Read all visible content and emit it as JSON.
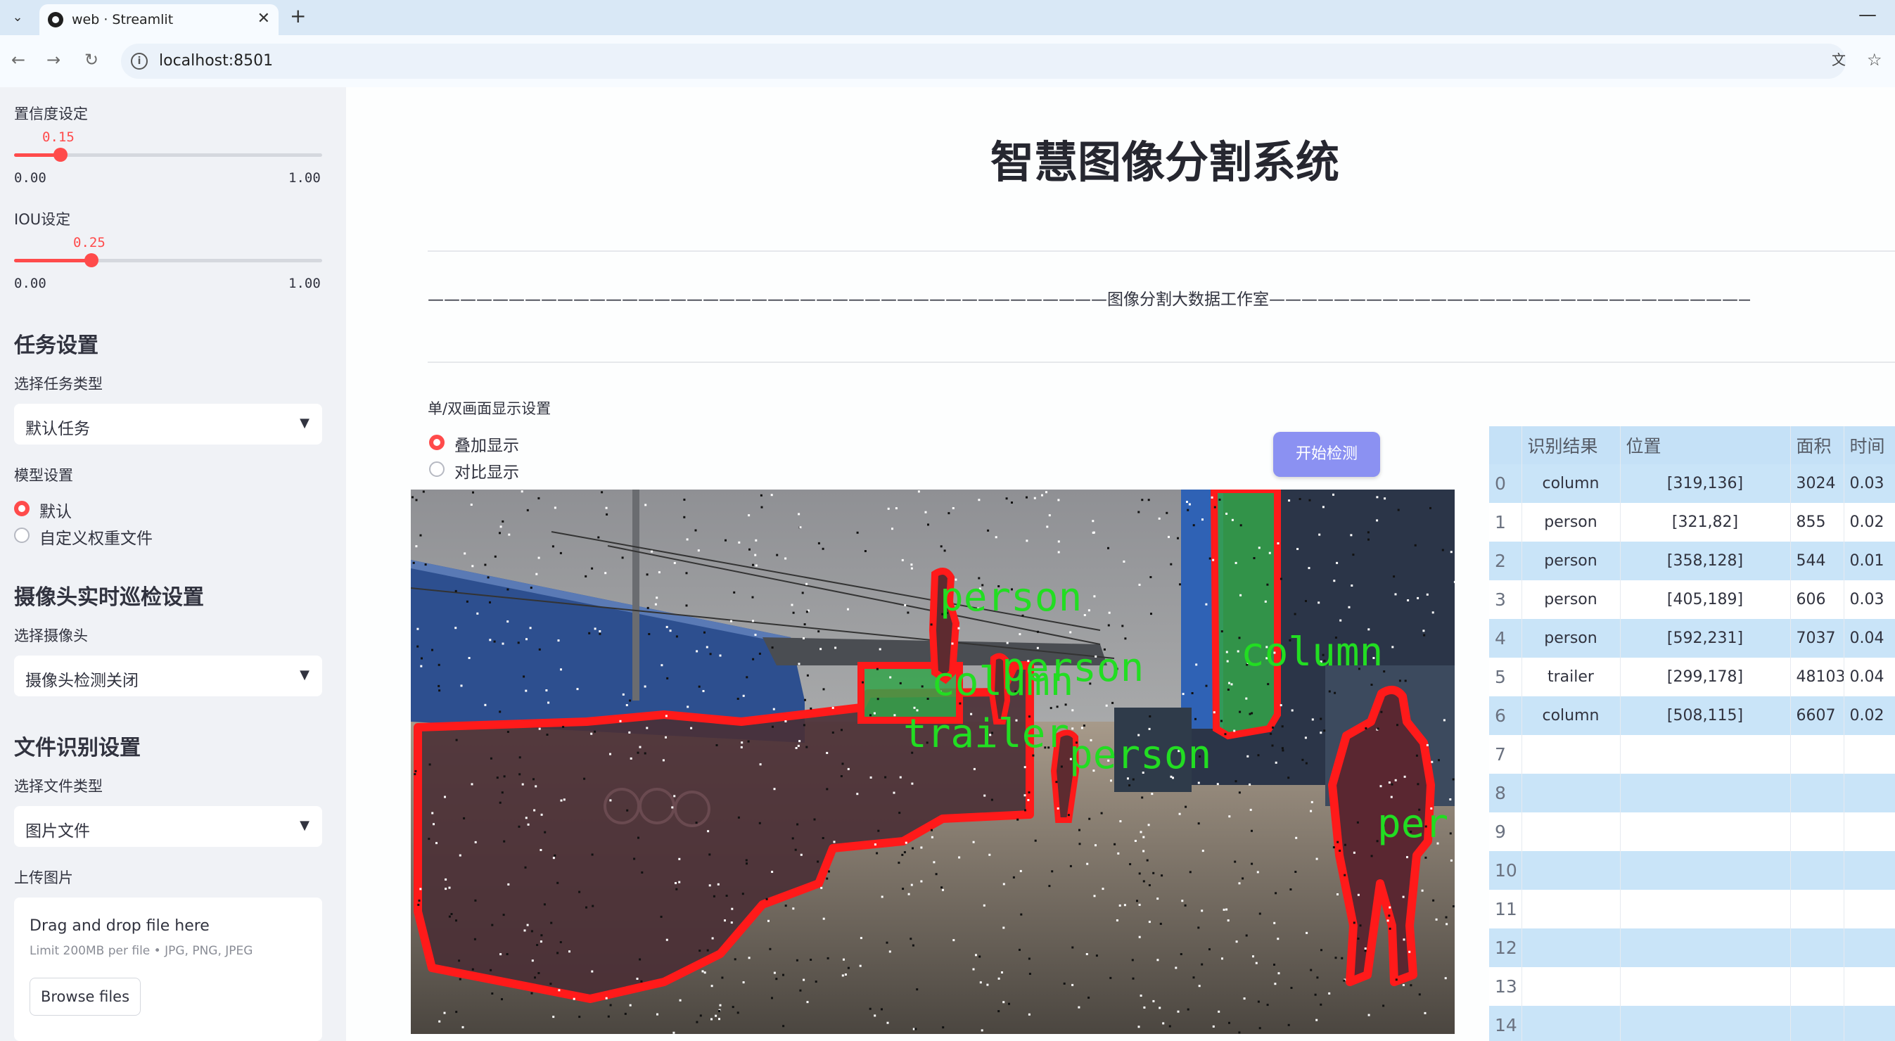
{
  "browser": {
    "tab_title": "web · Streamlit",
    "url": "localhost:8501"
  },
  "sidebar": {
    "confidence": {
      "label": "置信度设定",
      "value": "0.15",
      "fraction": 0.15,
      "min": "0.00",
      "max": "1.00"
    },
    "iou": {
      "label": "IOU设定",
      "value": "0.25",
      "fraction": 0.25,
      "min": "0.00",
      "max": "1.00"
    },
    "task_settings": {
      "heading": "任务设置",
      "select_label": "选择任务类型",
      "selected": "默认任务"
    },
    "model_settings": {
      "label": "模型设置",
      "options": [
        "默认",
        "自定义权重文件"
      ],
      "selected_index": 0
    },
    "camera": {
      "heading": "摄像头实时巡检设置",
      "select_label": "选择摄像头",
      "selected": "摄像头检测关闭"
    },
    "file_settings": {
      "heading": "文件识别设置",
      "select_label": "选择文件类型",
      "selected": "图片文件"
    },
    "upload": {
      "label": "上传图片",
      "title": "Drag and drop file here",
      "limit": "Limit 200MB per file • JPG, PNG, JPEG",
      "button": "Browse files"
    }
  },
  "main": {
    "title": "智慧图像分割系统",
    "studio_line": "——————————————————————————————————————————图像分割大数据工作室——————————————————————————————————————————",
    "display": {
      "label": "单/双画面显示设置",
      "options": [
        "叠加显示",
        "对比显示"
      ],
      "selected_index": 0
    },
    "start_button": "开始检测",
    "detections": [
      "person",
      "column",
      "person",
      "trailer",
      "person",
      "column",
      "per"
    ]
  },
  "results_table": {
    "headers": [
      "",
      "识别结果",
      "位置",
      "面积",
      "时间"
    ],
    "rows": [
      [
        "0",
        "column",
        "[319,136]",
        "3024",
        "0.03"
      ],
      [
        "1",
        "person",
        "[321,82]",
        "855",
        "0.02"
      ],
      [
        "2",
        "person",
        "[358,128]",
        "544",
        "0.01"
      ],
      [
        "3",
        "person",
        "[405,189]",
        "606",
        "0.03"
      ],
      [
        "4",
        "person",
        "[592,231]",
        "7037",
        "0.04"
      ],
      [
        "5",
        "trailer",
        "[299,178]",
        "48103",
        "0.04"
      ],
      [
        "6",
        "column",
        "[508,115]",
        "6607",
        "0.02"
      ],
      [
        "7",
        "",
        "",
        "",
        ""
      ],
      [
        "8",
        "",
        "",
        "",
        ""
      ],
      [
        "9",
        "",
        "",
        "",
        ""
      ],
      [
        "10",
        "",
        "",
        "",
        ""
      ],
      [
        "11",
        "",
        "",
        "",
        ""
      ],
      [
        "12",
        "",
        "",
        "",
        ""
      ],
      [
        "13",
        "",
        "",
        "",
        ""
      ],
      [
        "14",
        "",
        "",
        "",
        ""
      ]
    ]
  },
  "colors": {
    "accent": "#ff4b4b",
    "button": "#8b91f2",
    "mask_red": "#ff1a1a",
    "label_green": "#22dd22"
  }
}
